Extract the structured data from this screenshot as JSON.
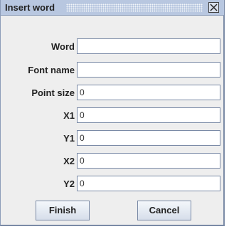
{
  "window": {
    "title": "Insert word",
    "close_icon": "close-icon"
  },
  "form": {
    "fields": [
      {
        "label": "Word",
        "value": ""
      },
      {
        "label": "Font name",
        "value": ""
      },
      {
        "label": "Point size",
        "value": "0"
      },
      {
        "label": "X1",
        "value": "0"
      },
      {
        "label": "Y1",
        "value": "0"
      },
      {
        "label": "X2",
        "value": "0"
      },
      {
        "label": "Y2",
        "value": "0"
      }
    ]
  },
  "buttons": {
    "finish_label": "Finish",
    "cancel_label": "Cancel"
  }
}
